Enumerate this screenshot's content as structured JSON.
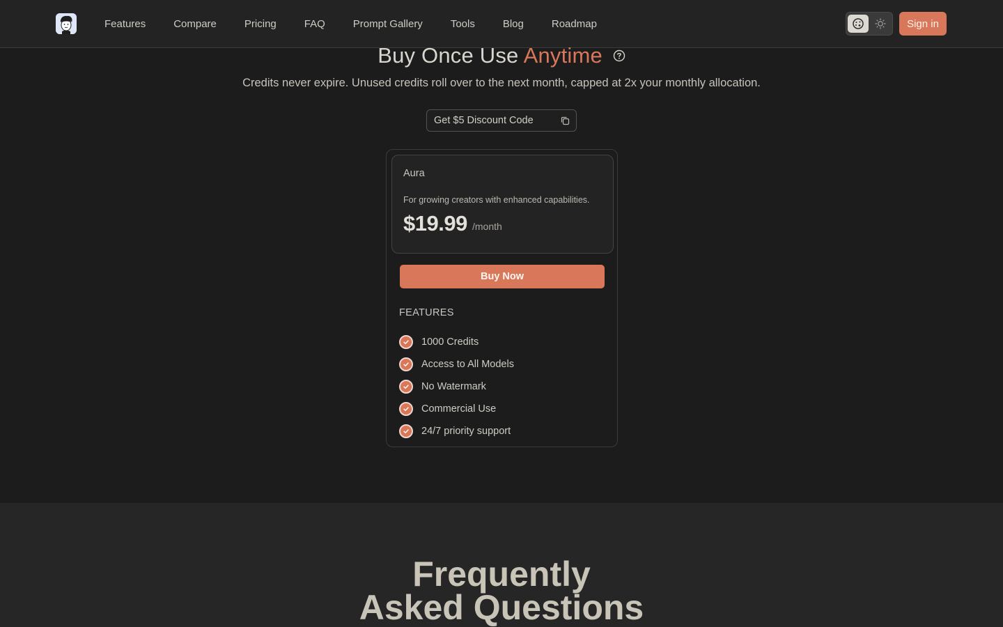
{
  "header": {
    "logo_name": "avatar-logo",
    "nav": [
      {
        "label": "Features"
      },
      {
        "label": "Compare"
      },
      {
        "label": "Pricing"
      },
      {
        "label": "FAQ"
      },
      {
        "label": "Prompt Gallery"
      },
      {
        "label": "Tools"
      },
      {
        "label": "Blog"
      },
      {
        "label": "Roadmap"
      }
    ],
    "theme_options": [
      "system",
      "light"
    ],
    "selected_theme": "system",
    "signin_label": "Sign in"
  },
  "hero": {
    "title_prefix": "Buy Once Use",
    "title_accent": "Anytime",
    "subtitle": "Credits never expire. Unused credits roll over to the next month, capped at 2x your monthly allocation.",
    "discount_label": "Get $5 Discount Code"
  },
  "plan": {
    "name": "Aura",
    "description": "For growing creators with enhanced capabilities.",
    "price": "$19.99",
    "period": "/month",
    "buy_label": "Buy Now",
    "features_heading": "FEATURES",
    "features": [
      "1000 Credits",
      "Access to All Models",
      "No Watermark",
      "Commercial Use",
      "24/7 priority support"
    ]
  },
  "faq": {
    "title_line1": "Frequently",
    "title_line2": "Asked Questions"
  },
  "colors": {
    "accent": "#d9775a",
    "background": "#1c1c1c",
    "header": "#232323"
  }
}
